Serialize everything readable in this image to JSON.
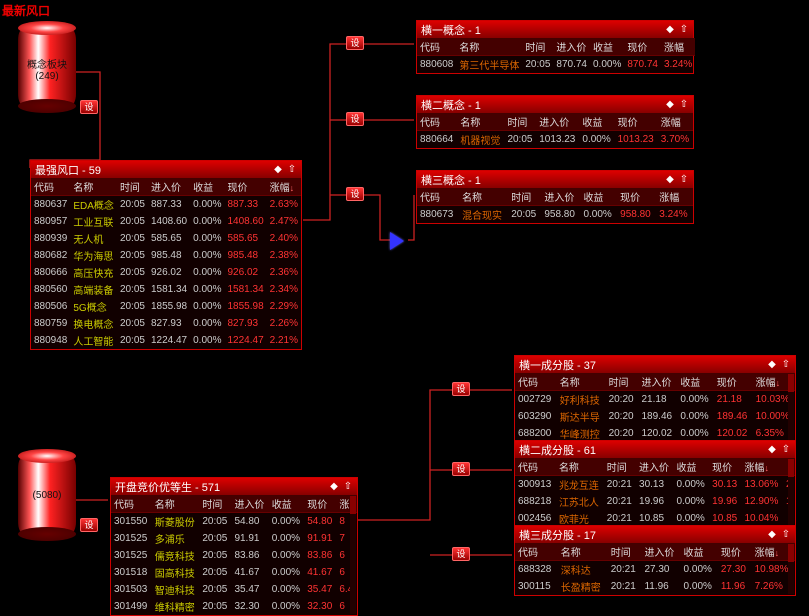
{
  "colors": {
    "accent": "#d00",
    "up": "#f33",
    "down": "#3c3",
    "name": "#d60"
  },
  "topTitle": "最新风口",
  "setLabel": "设",
  "cylinder1": {
    "label": "概念板块",
    "count": "(249)"
  },
  "cylinder2": {
    "label": "(5080)"
  },
  "cols": {
    "code": "代码",
    "name": "名称",
    "time": "时间",
    "enter": "进入价",
    "gain": "收益",
    "now": "现价",
    "chg": "涨幅"
  },
  "panels": {
    "strongest": {
      "title": "最强风口",
      "count": "59",
      "rows": [
        {
          "code": "880637",
          "name": "EDA概念",
          "time": "20:05",
          "enter": "887.33",
          "gain": "0.00%",
          "now": "887.33",
          "chg": "2.63%"
        },
        {
          "code": "880957",
          "name": "工业互联",
          "time": "20:05",
          "enter": "1408.60",
          "gain": "0.00%",
          "now": "1408.60",
          "chg": "2.47%"
        },
        {
          "code": "880939",
          "name": "无人机",
          "time": "20:05",
          "enter": "585.65",
          "gain": "0.00%",
          "now": "585.65",
          "chg": "2.40%"
        },
        {
          "code": "880682",
          "name": "华为海思",
          "time": "20:05",
          "enter": "985.48",
          "gain": "0.00%",
          "now": "985.48",
          "chg": "2.38%"
        },
        {
          "code": "880666",
          "name": "高压快充",
          "time": "20:05",
          "enter": "926.02",
          "gain": "0.00%",
          "now": "926.02",
          "chg": "2.36%"
        },
        {
          "code": "880560",
          "name": "高端装备",
          "time": "20:05",
          "enter": "1581.34",
          "gain": "0.00%",
          "now": "1581.34",
          "chg": "2.34%"
        },
        {
          "code": "880506",
          "name": "5G概念",
          "time": "20:05",
          "enter": "1855.98",
          "gain": "0.00%",
          "now": "1855.98",
          "chg": "2.29%"
        },
        {
          "code": "880759",
          "name": "换电概念",
          "time": "20:05",
          "enter": "827.93",
          "gain": "0.00%",
          "now": "827.93",
          "chg": "2.26%"
        },
        {
          "code": "880948",
          "name": "人工智能",
          "time": "20:05",
          "enter": "1224.47",
          "gain": "0.00%",
          "now": "1224.47",
          "chg": "2.21%"
        }
      ]
    },
    "h1": {
      "title": "横一概念",
      "count": "1",
      "rows": [
        {
          "code": "880608",
          "name": "第三代半导体",
          "time": "20:05",
          "enter": "870.74",
          "gain": "0.00%",
          "now": "870.74",
          "chg": "3.24%"
        }
      ]
    },
    "h2": {
      "title": "横二概念",
      "count": "1",
      "rows": [
        {
          "code": "880664",
          "name": "机器视觉",
          "time": "20:05",
          "enter": "1013.23",
          "gain": "0.00%",
          "now": "1013.23",
          "chg": "3.70%"
        }
      ]
    },
    "h3": {
      "title": "横三概念",
      "count": "1",
      "rows": [
        {
          "code": "880673",
          "name": "混合现实",
          "time": "20:05",
          "enter": "958.80",
          "gain": "0.00%",
          "now": "958.80",
          "chg": "3.24%"
        }
      ]
    },
    "c1": {
      "title": "横一成分股",
      "count": "37",
      "rows": [
        {
          "code": "002729",
          "name": "好利科技",
          "time": "20:20",
          "enter": "21.18",
          "gain": "0.00%",
          "now": "21.18",
          "chg": "10.03%"
        },
        {
          "code": "603290",
          "name": "斯达半导",
          "time": "20:20",
          "enter": "189.46",
          "gain": "0.00%",
          "now": "189.46",
          "chg": "10.00%"
        },
        {
          "code": "688200",
          "name": "华峰测控",
          "time": "20:20",
          "enter": "120.02",
          "gain": "0.00%",
          "now": "120.02",
          "chg": "6.35%"
        }
      ]
    },
    "c2": {
      "title": "横二成分股",
      "count": "61",
      "rows": [
        {
          "code": "300913",
          "name": "兆龙互连",
          "time": "20:21",
          "enter": "30.13",
          "gain": "0.00%",
          "now": "30.13",
          "chg": "13.06%",
          "extra": "2"
        },
        {
          "code": "688218",
          "name": "江苏北人",
          "time": "20:21",
          "enter": "19.96",
          "gain": "0.00%",
          "now": "19.96",
          "chg": "12.90%",
          "extra": "1"
        },
        {
          "code": "002456",
          "name": "欧菲光",
          "time": "20:21",
          "enter": "10.85",
          "gain": "0.00%",
          "now": "10.85",
          "chg": "10.04%",
          "extra": ""
        }
      ]
    },
    "c3": {
      "title": "横三成分股",
      "count": "17",
      "rows": [
        {
          "code": "688328",
          "name": "深科达",
          "time": "20:21",
          "enter": "27.30",
          "gain": "0.00%",
          "now": "27.30",
          "chg": "10.98%"
        },
        {
          "code": "300115",
          "name": "长盈精密",
          "time": "20:21",
          "enter": "11.96",
          "gain": "0.00%",
          "now": "11.96",
          "chg": "7.26%"
        }
      ]
    },
    "open": {
      "title": "开盘竞价优等生",
      "count": "571",
      "rows": [
        {
          "code": "301550",
          "name": "斯菱股份",
          "time": "20:05",
          "enter": "54.80",
          "gain": "0.00%",
          "now": "54.80",
          "chg": "8"
        },
        {
          "code": "301525",
          "name": "多浦乐",
          "time": "20:05",
          "enter": "91.91",
          "gain": "0.00%",
          "now": "91.91",
          "chg": "7"
        },
        {
          "code": "301525",
          "name": "儒竞科技",
          "time": "20:05",
          "enter": "83.86",
          "gain": "0.00%",
          "now": "83.86",
          "chg": "6"
        },
        {
          "code": "301518",
          "name": "固高科技",
          "time": "20:05",
          "enter": "41.67",
          "gain": "0.00%",
          "now": "41.67",
          "chg": "6"
        },
        {
          "code": "301503",
          "name": "智迪科技",
          "time": "20:05",
          "enter": "35.47",
          "gain": "0.00%",
          "now": "35.47",
          "chg": "6.4"
        },
        {
          "code": "301499",
          "name": "维科精密",
          "time": "20:05",
          "enter": "32.30",
          "gain": "0.00%",
          "now": "32.30",
          "chg": "6"
        }
      ]
    }
  }
}
